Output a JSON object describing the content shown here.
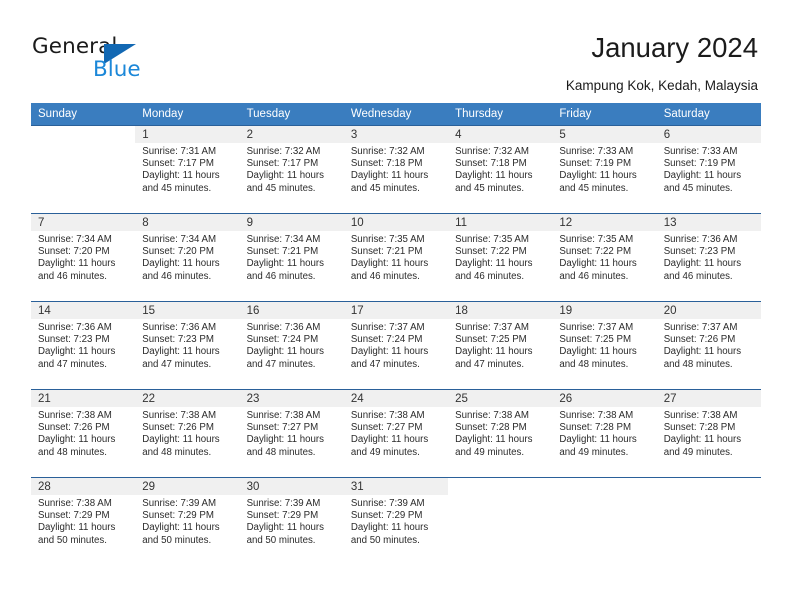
{
  "brand": {
    "name_part1": "General",
    "name_part2": "Blue",
    "triangle_color": "#1268b3",
    "blue_color": "#1b87d8"
  },
  "header": {
    "title": "January 2024",
    "subtitle": "Kampung Kok, Kedah, Malaysia"
  },
  "colors": {
    "header_row_bg": "#3a7dbf",
    "header_row_text": "#ffffff",
    "daynum_band_bg": "#f0f0f0",
    "row_divider": "#2a6099"
  },
  "calendar": {
    "weekday_headers": [
      "Sunday",
      "Monday",
      "Tuesday",
      "Wednesday",
      "Thursday",
      "Friday",
      "Saturday"
    ],
    "weeks": [
      [
        {
          "day": "",
          "lines": []
        },
        {
          "day": "1",
          "lines": [
            "Sunrise: 7:31 AM",
            "Sunset: 7:17 PM",
            "Daylight: 11 hours",
            "and 45 minutes."
          ]
        },
        {
          "day": "2",
          "lines": [
            "Sunrise: 7:32 AM",
            "Sunset: 7:17 PM",
            "Daylight: 11 hours",
            "and 45 minutes."
          ]
        },
        {
          "day": "3",
          "lines": [
            "Sunrise: 7:32 AM",
            "Sunset: 7:18 PM",
            "Daylight: 11 hours",
            "and 45 minutes."
          ]
        },
        {
          "day": "4",
          "lines": [
            "Sunrise: 7:32 AM",
            "Sunset: 7:18 PM",
            "Daylight: 11 hours",
            "and 45 minutes."
          ]
        },
        {
          "day": "5",
          "lines": [
            "Sunrise: 7:33 AM",
            "Sunset: 7:19 PM",
            "Daylight: 11 hours",
            "and 45 minutes."
          ]
        },
        {
          "day": "6",
          "lines": [
            "Sunrise: 7:33 AM",
            "Sunset: 7:19 PM",
            "Daylight: 11 hours",
            "and 45 minutes."
          ]
        }
      ],
      [
        {
          "day": "7",
          "lines": [
            "Sunrise: 7:34 AM",
            "Sunset: 7:20 PM",
            "Daylight: 11 hours",
            "and 46 minutes."
          ]
        },
        {
          "day": "8",
          "lines": [
            "Sunrise: 7:34 AM",
            "Sunset: 7:20 PM",
            "Daylight: 11 hours",
            "and 46 minutes."
          ]
        },
        {
          "day": "9",
          "lines": [
            "Sunrise: 7:34 AM",
            "Sunset: 7:21 PM",
            "Daylight: 11 hours",
            "and 46 minutes."
          ]
        },
        {
          "day": "10",
          "lines": [
            "Sunrise: 7:35 AM",
            "Sunset: 7:21 PM",
            "Daylight: 11 hours",
            "and 46 minutes."
          ]
        },
        {
          "day": "11",
          "lines": [
            "Sunrise: 7:35 AM",
            "Sunset: 7:22 PM",
            "Daylight: 11 hours",
            "and 46 minutes."
          ]
        },
        {
          "day": "12",
          "lines": [
            "Sunrise: 7:35 AM",
            "Sunset: 7:22 PM",
            "Daylight: 11 hours",
            "and 46 minutes."
          ]
        },
        {
          "day": "13",
          "lines": [
            "Sunrise: 7:36 AM",
            "Sunset: 7:23 PM",
            "Daylight: 11 hours",
            "and 46 minutes."
          ]
        }
      ],
      [
        {
          "day": "14",
          "lines": [
            "Sunrise: 7:36 AM",
            "Sunset: 7:23 PM",
            "Daylight: 11 hours",
            "and 47 minutes."
          ]
        },
        {
          "day": "15",
          "lines": [
            "Sunrise: 7:36 AM",
            "Sunset: 7:23 PM",
            "Daylight: 11 hours",
            "and 47 minutes."
          ]
        },
        {
          "day": "16",
          "lines": [
            "Sunrise: 7:36 AM",
            "Sunset: 7:24 PM",
            "Daylight: 11 hours",
            "and 47 minutes."
          ]
        },
        {
          "day": "17",
          "lines": [
            "Sunrise: 7:37 AM",
            "Sunset: 7:24 PM",
            "Daylight: 11 hours",
            "and 47 minutes."
          ]
        },
        {
          "day": "18",
          "lines": [
            "Sunrise: 7:37 AM",
            "Sunset: 7:25 PM",
            "Daylight: 11 hours",
            "and 47 minutes."
          ]
        },
        {
          "day": "19",
          "lines": [
            "Sunrise: 7:37 AM",
            "Sunset: 7:25 PM",
            "Daylight: 11 hours",
            "and 48 minutes."
          ]
        },
        {
          "day": "20",
          "lines": [
            "Sunrise: 7:37 AM",
            "Sunset: 7:26 PM",
            "Daylight: 11 hours",
            "and 48 minutes."
          ]
        }
      ],
      [
        {
          "day": "21",
          "lines": [
            "Sunrise: 7:38 AM",
            "Sunset: 7:26 PM",
            "Daylight: 11 hours",
            "and 48 minutes."
          ]
        },
        {
          "day": "22",
          "lines": [
            "Sunrise: 7:38 AM",
            "Sunset: 7:26 PM",
            "Daylight: 11 hours",
            "and 48 minutes."
          ]
        },
        {
          "day": "23",
          "lines": [
            "Sunrise: 7:38 AM",
            "Sunset: 7:27 PM",
            "Daylight: 11 hours",
            "and 48 minutes."
          ]
        },
        {
          "day": "24",
          "lines": [
            "Sunrise: 7:38 AM",
            "Sunset: 7:27 PM",
            "Daylight: 11 hours",
            "and 49 minutes."
          ]
        },
        {
          "day": "25",
          "lines": [
            "Sunrise: 7:38 AM",
            "Sunset: 7:28 PM",
            "Daylight: 11 hours",
            "and 49 minutes."
          ]
        },
        {
          "day": "26",
          "lines": [
            "Sunrise: 7:38 AM",
            "Sunset: 7:28 PM",
            "Daylight: 11 hours",
            "and 49 minutes."
          ]
        },
        {
          "day": "27",
          "lines": [
            "Sunrise: 7:38 AM",
            "Sunset: 7:28 PM",
            "Daylight: 11 hours",
            "and 49 minutes."
          ]
        }
      ],
      [
        {
          "day": "28",
          "lines": [
            "Sunrise: 7:38 AM",
            "Sunset: 7:29 PM",
            "Daylight: 11 hours",
            "and 50 minutes."
          ]
        },
        {
          "day": "29",
          "lines": [
            "Sunrise: 7:39 AM",
            "Sunset: 7:29 PM",
            "Daylight: 11 hours",
            "and 50 minutes."
          ]
        },
        {
          "day": "30",
          "lines": [
            "Sunrise: 7:39 AM",
            "Sunset: 7:29 PM",
            "Daylight: 11 hours",
            "and 50 minutes."
          ]
        },
        {
          "day": "31",
          "lines": [
            "Sunrise: 7:39 AM",
            "Sunset: 7:29 PM",
            "Daylight: 11 hours",
            "and 50 minutes."
          ]
        },
        {
          "day": "",
          "lines": []
        },
        {
          "day": "",
          "lines": []
        },
        {
          "day": "",
          "lines": []
        }
      ]
    ]
  }
}
